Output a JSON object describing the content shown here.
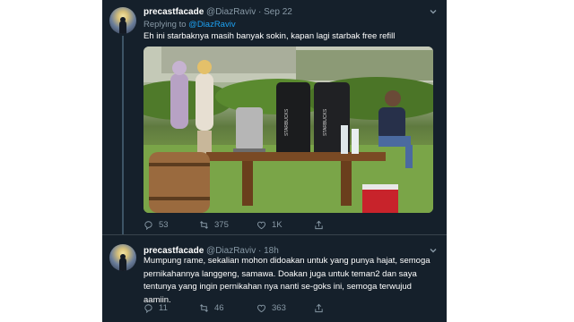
{
  "colors": {
    "background": "#15202b",
    "primary_text": "#ffffff",
    "secondary_text": "#8899a6",
    "link": "#1da1f2",
    "divider": "#38444d"
  },
  "tweets": [
    {
      "name": "precastfacade",
      "handle": "@DiazRaviv",
      "separator": "·",
      "time": "Sep 22",
      "replying_prefix": "Replying to ",
      "replying_handle": "@DiazRaviv",
      "text": "Eh ini starbaknya masih banyak sokin, kapan lagi starbak free refill",
      "media_alt": "photo",
      "media_bag_label_1": "STARBUCKS",
      "media_bag_label_2": "STARBUCKS",
      "counts": {
        "reply": "53",
        "retweet": "375",
        "like": "1K"
      },
      "icons": {
        "reply": "reply-icon",
        "retweet": "retweet-icon",
        "like": "heart-icon",
        "share": "share-icon",
        "menu": "chevron-down-icon"
      }
    },
    {
      "name": "precastfacade",
      "handle": "@DiazRaviv",
      "separator": "·",
      "time": "18h",
      "text": "Mumpung rame, sekalian mohon didoakan untuk yang punya hajat, semoga pernikahannya langgeng, samawa. Doakan juga untuk teman2 dan saya tentunya yang ingin pernikahan nya nanti se-goks ini, semoga terwujud aamiin.",
      "counts": {
        "reply": "11",
        "retweet": "46",
        "like": "363"
      },
      "icons": {
        "reply": "reply-icon",
        "retweet": "retweet-icon",
        "like": "heart-icon",
        "share": "share-icon",
        "menu": "chevron-down-icon"
      }
    }
  ]
}
